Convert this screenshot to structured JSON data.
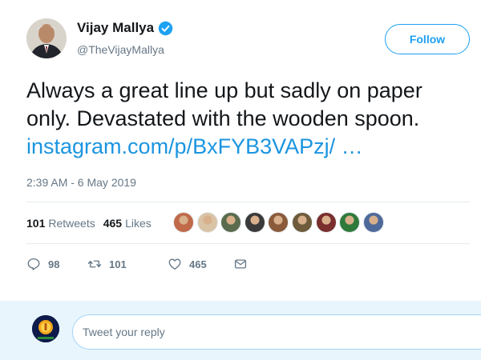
{
  "author": {
    "name": "Vijay Mallya",
    "handle": "@TheVijayMallya",
    "verified": true
  },
  "follow_button": {
    "label": "Follow"
  },
  "tweet": {
    "text_line1": "Always a great line up but sadly on paper",
    "text_line2": "only. Devastated with the wooden spoon.",
    "link": "instagram.com/p/BxFYB3VAPzj/  …",
    "timestamp": "2:39 AM - 6 May 2019"
  },
  "stats": {
    "retweets_count": "101",
    "retweets_label": "Retweets",
    "likes_count": "465",
    "likes_label": "Likes"
  },
  "likers": [
    {
      "color": "#c06a4a"
    },
    {
      "color": "#d9c3a5"
    },
    {
      "color": "#5a6b4e"
    },
    {
      "color": "#3a3a3a"
    },
    {
      "color": "#8a5a3a"
    },
    {
      "color": "#6e5b3c"
    },
    {
      "color": "#7a2e2e"
    },
    {
      "color": "#2f7a3a"
    },
    {
      "color": "#4e6a9a"
    }
  ],
  "actions": {
    "replies": "98",
    "retweets": "101",
    "likes": "465"
  },
  "reply_box": {
    "placeholder": "Tweet your reply"
  },
  "colors": {
    "brand_blue": "#1da1f2",
    "link_blue": "#1b95e0",
    "muted_text": "#657786",
    "reply_bar_bg": "#e8f5fd"
  }
}
